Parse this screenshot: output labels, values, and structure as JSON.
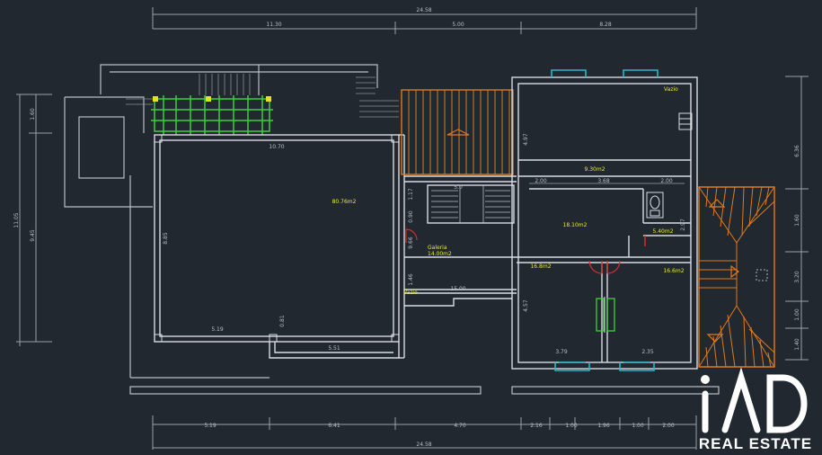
{
  "dimensions": {
    "top_total": "24.58",
    "top_segments": [
      "11.30",
      "5.00",
      "8.28"
    ],
    "bottom_total": "24.58",
    "bottom_segments": [
      "5.19",
      "6.41",
      "4.70",
      "2.16",
      "1.00",
      "1.96",
      "1.00",
      "2.00"
    ],
    "left_overall": "11.05",
    "left_inner": "9.45",
    "left_small": "1.60",
    "right_overall": "6.36",
    "right_segments": [
      "1.60",
      "3.20",
      "1.00",
      "1.40"
    ],
    "living_width": "10.70",
    "living_height": "8.85",
    "living_bottom": "5.19",
    "living_bottom2": "5.51",
    "living_notch": "0.81",
    "gallery_height": "9.66",
    "gallery_small": [
      "1.17",
      "0.90",
      "1.46"
    ],
    "corridor": "15.00",
    "hall_dims": [
      "2.00",
      "3.68",
      "2.00"
    ],
    "room_right_height": "4.97",
    "bath_height": "2.97",
    "bed_left_height": "4.57",
    "windows_bottom": [
      "3.79",
      "2.35"
    ],
    "stair_label": "5.0"
  },
  "areas": {
    "living": "80.76m2",
    "gallery_label": "Galeria",
    "gallery": "14.00m2",
    "vazio_top": "Vazio",
    "vazio_left": "Vazio",
    "room_top_right": "9.30m2",
    "hall": "18.10m2",
    "bath": "5.40m2",
    "bed_left": "16.8m2",
    "bed_right": "16.6m2"
  },
  "colors": {
    "background": "#212830",
    "wall": "#d9dde2",
    "dim_line": "#9aa1a8",
    "roof": "#e07a1c",
    "window": "#29b6c8",
    "door": "#d12b2b",
    "green_element": "#3bd13b",
    "yellow": "#e3e31c",
    "area_text": "#e8e83a"
  },
  "logo": {
    "mark": "iAD",
    "tagline": "REAL ESTATE"
  }
}
